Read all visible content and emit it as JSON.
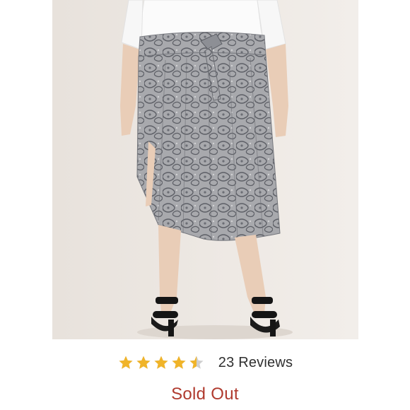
{
  "product": {
    "image_alt": "Snake print pleated midi skirt with tie waist, worn with white shirt and black block-heel sandals"
  },
  "rating": {
    "value": 4.5,
    "max": 5,
    "reviews_label": "23 Reviews",
    "star_color": "#f0b429",
    "star_empty_color": "#cfcfcf"
  },
  "status": {
    "label": "Sold Out",
    "color": "#b03a2e"
  },
  "icons": {
    "star": "star-icon"
  }
}
